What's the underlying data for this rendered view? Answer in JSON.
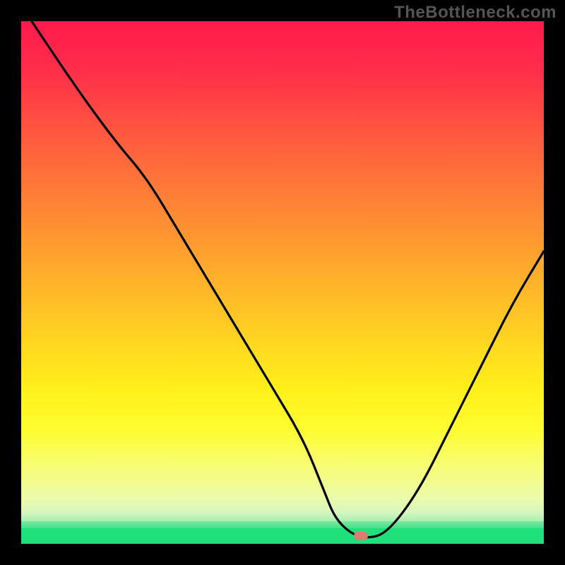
{
  "watermark": "TheBottleneck.com",
  "colors": {
    "marker": "#df7a70",
    "curve": "#000000",
    "green_band": "#1fe07a"
  },
  "chart_data": {
    "type": "line",
    "title": "",
    "xlabel": "",
    "ylabel": "",
    "xlim": [
      0,
      100
    ],
    "ylim": [
      0,
      100
    ],
    "grid": false,
    "legend": false,
    "series": [
      {
        "name": "bottleneck-curve",
        "x": [
          2,
          10,
          18,
          24,
          30,
          36,
          42,
          48,
          54,
          58,
          60,
          63,
          66,
          70,
          76,
          82,
          88,
          94,
          100
        ],
        "y": [
          100,
          88,
          77,
          70,
          60,
          50,
          40,
          30,
          20,
          10,
          5,
          2,
          1,
          2,
          10,
          22,
          34,
          46,
          56
        ]
      }
    ],
    "annotations": [
      {
        "name": "optimal-point",
        "x": 65,
        "y": 1.5
      }
    ],
    "background_gradient": {
      "type": "vertical",
      "stops": [
        {
          "pct": 0,
          "color": "#ff1a4d"
        },
        {
          "pct": 25,
          "color": "#ff6b3c"
        },
        {
          "pct": 50,
          "color": "#ffbb28"
        },
        {
          "pct": 75,
          "color": "#fff21a"
        },
        {
          "pct": 94,
          "color": "#e8fabb"
        },
        {
          "pct": 96,
          "color": "#9eecb0"
        },
        {
          "pct": 97.5,
          "color": "#1fe07a"
        },
        {
          "pct": 100,
          "color": "#1fe07a"
        }
      ]
    }
  }
}
